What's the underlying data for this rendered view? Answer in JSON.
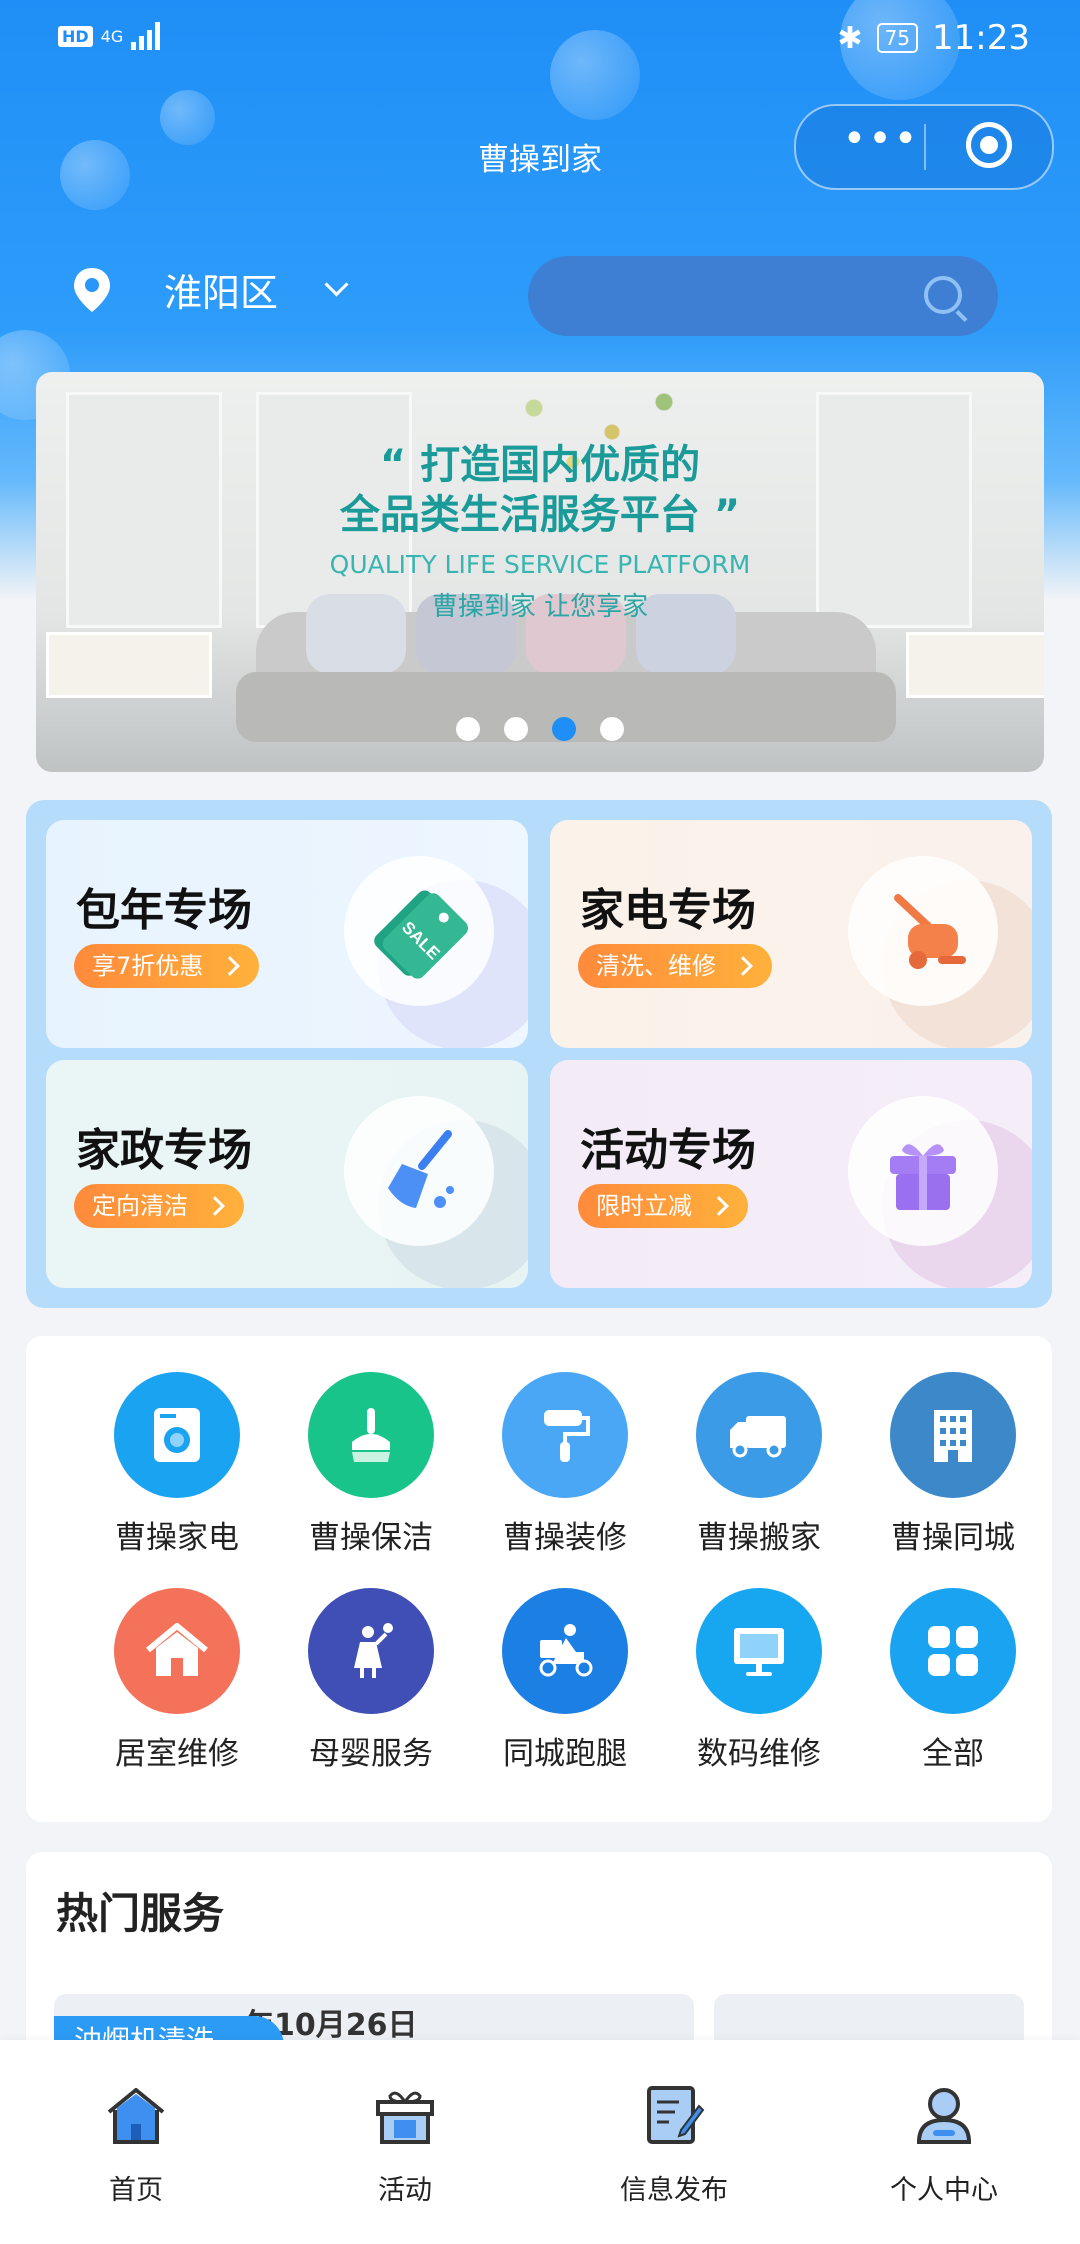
{
  "status_bar": {
    "network_badge": "HD",
    "signal": "4G",
    "battery": "75",
    "time": "11:23"
  },
  "app": {
    "title": "曹操到家"
  },
  "location": {
    "name": "淮阳区"
  },
  "banner": {
    "title_line1": "“ 打造国内优质的",
    "title_line2": "全品类生活服务平台 ”",
    "subtitle": "QUALITY LIFE SERVICE PLATFORM",
    "tagline": "曹操到家 让您享家",
    "active_index": 2
  },
  "promos": [
    {
      "title": "包年专场",
      "button": "享7折优惠",
      "icon": "sale-tag-icon"
    },
    {
      "title": "家电专场",
      "button": "清洗、维修",
      "icon": "vacuum-icon"
    },
    {
      "title": "家政专场",
      "button": "定向清洁",
      "icon": "broom-icon"
    },
    {
      "title": "活动专场",
      "button": "限时立减",
      "icon": "gift-icon"
    }
  ],
  "services": [
    {
      "label": "曹操家电",
      "color": "#1aa3f0",
      "icon": "washer-icon"
    },
    {
      "label": "曹操保洁",
      "color": "#19c48a",
      "icon": "broom-icon"
    },
    {
      "label": "曹操装修",
      "color": "#4aa7f5",
      "icon": "paint-roller-icon"
    },
    {
      "label": "曹操搬家",
      "color": "#3b9be6",
      "icon": "truck-icon"
    },
    {
      "label": "曹操同城",
      "color": "#3c88c8",
      "icon": "building-icon"
    },
    {
      "label": "居室维修",
      "color": "#f5725a",
      "icon": "house-icon"
    },
    {
      "label": "母婴服务",
      "color": "#3f4fb5",
      "icon": "mother-baby-icon"
    },
    {
      "label": "同城跑腿",
      "color": "#1c7fe3",
      "icon": "delivery-scooter-icon"
    },
    {
      "label": "数码维修",
      "color": "#17a6f0",
      "icon": "monitor-icon"
    },
    {
      "label": "全部",
      "color": "#1aa3f0",
      "icon": "grid-icon"
    }
  ],
  "hot_services": {
    "title": "热门服务",
    "cards": [
      {
        "badge": "油烟机清洗",
        "text": "年10月26日"
      },
      {
        "badge": "",
        "text": ""
      }
    ]
  },
  "tabbar": [
    {
      "label": "首页",
      "icon": "home-icon",
      "active": true
    },
    {
      "label": "活动",
      "icon": "gift-box-icon",
      "active": false
    },
    {
      "label": "信息发布",
      "icon": "edit-document-icon",
      "active": false
    },
    {
      "label": "个人中心",
      "icon": "user-icon",
      "active": false
    }
  ]
}
